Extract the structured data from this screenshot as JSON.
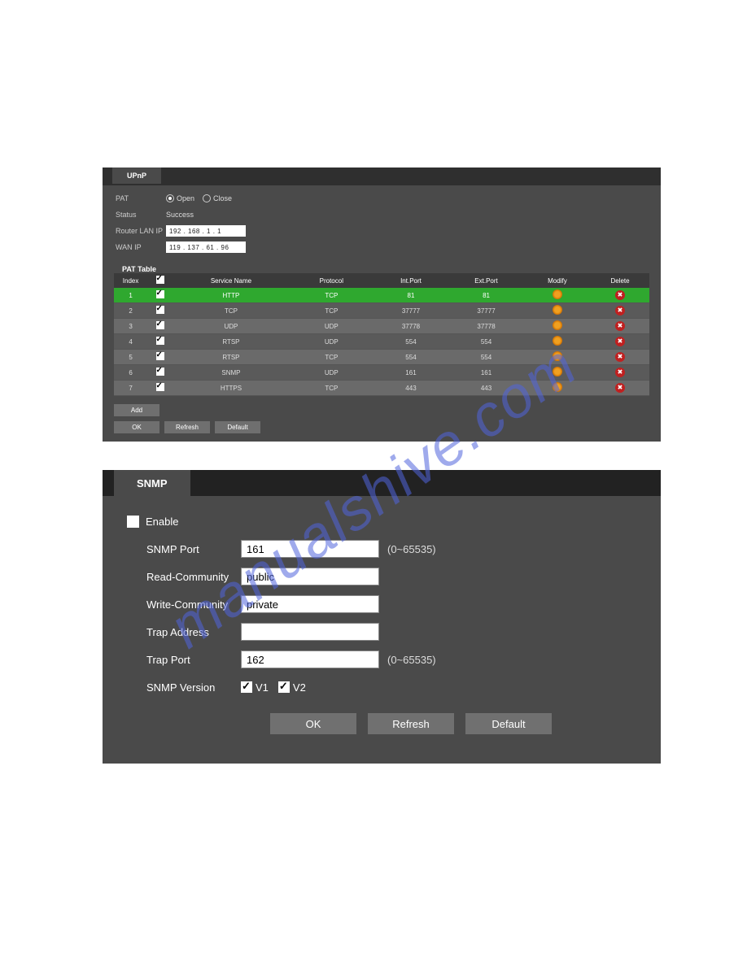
{
  "watermark": "manualshive.com",
  "upnp": {
    "tab": "UPnP",
    "pat_label": "PAT",
    "open_label": "Open",
    "close_label": "Close",
    "pat_selected": "open",
    "status_label": "Status",
    "status_value": "Success",
    "router_label": "Router LAN IP",
    "router_ip": "192 . 168 . 1 . 1",
    "wan_label": "WAN IP",
    "wan_ip": "119 . 137 . 61 . 96",
    "table_title": "PAT Table",
    "headers": {
      "index": "Index",
      "check": "",
      "service": "Service Name",
      "protocol": "Protocol",
      "intport": "Int.Port",
      "extport": "Ext.Port",
      "modify": "Modify",
      "delete": "Delete"
    },
    "rows": [
      {
        "idx": "1",
        "chk": true,
        "svc": "HTTP",
        "proto": "TCP",
        "int": "81",
        "ext": "81",
        "sel": true
      },
      {
        "idx": "2",
        "chk": true,
        "svc": "TCP",
        "proto": "TCP",
        "int": "37777",
        "ext": "37777",
        "sel": false
      },
      {
        "idx": "3",
        "chk": true,
        "svc": "UDP",
        "proto": "UDP",
        "int": "37778",
        "ext": "37778",
        "sel": false
      },
      {
        "idx": "4",
        "chk": true,
        "svc": "RTSP",
        "proto": "UDP",
        "int": "554",
        "ext": "554",
        "sel": false
      },
      {
        "idx": "5",
        "chk": true,
        "svc": "RTSP",
        "proto": "TCP",
        "int": "554",
        "ext": "554",
        "sel": false
      },
      {
        "idx": "6",
        "chk": true,
        "svc": "SNMP",
        "proto": "UDP",
        "int": "161",
        "ext": "161",
        "sel": false
      },
      {
        "idx": "7",
        "chk": true,
        "svc": "HTTPS",
        "proto": "TCP",
        "int": "443",
        "ext": "443",
        "sel": false
      }
    ],
    "header_chk": true,
    "btn_add": "Add",
    "btn_ok": "OK",
    "btn_refresh": "Refresh",
    "btn_default": "Default"
  },
  "snmp": {
    "tab": "SNMP",
    "enable_label": "Enable",
    "enable_checked": false,
    "port_label": "SNMP Port",
    "port_value": "161",
    "port_hint": "(0~65535)",
    "read_label": "Read-Community",
    "read_value": "public",
    "write_label": "Write-Community",
    "write_value": "private",
    "trapaddr_label": "Trap Address",
    "trapaddr_value": "",
    "trapport_label": "Trap Port",
    "trapport_value": "162",
    "trapport_hint": "(0~65535)",
    "version_label": "SNMP Version",
    "v1_label": "V1",
    "v1_checked": true,
    "v2_label": "V2",
    "v2_checked": true,
    "btn_ok": "OK",
    "btn_refresh": "Refresh",
    "btn_default": "Default"
  }
}
